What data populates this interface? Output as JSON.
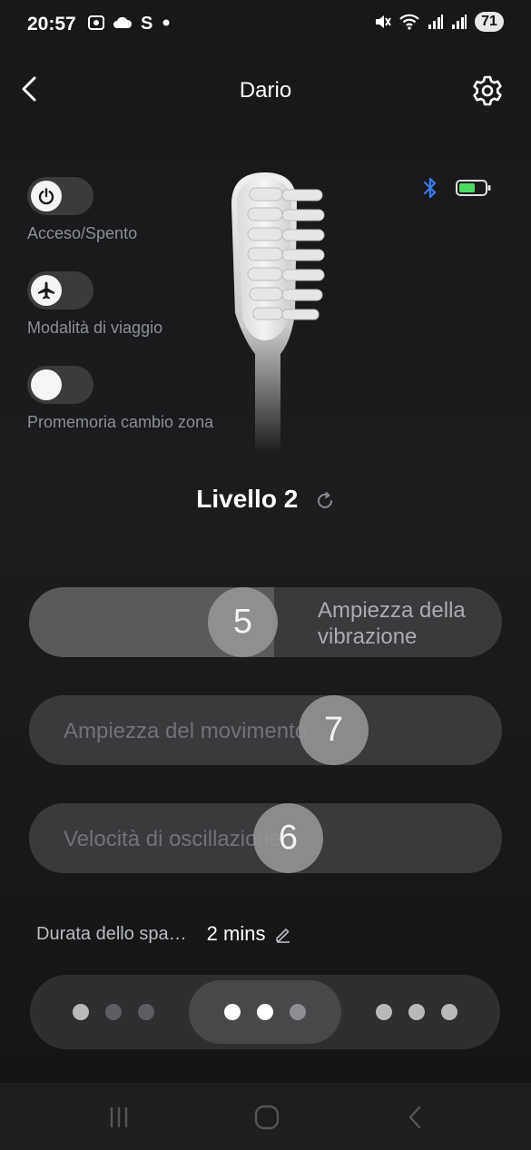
{
  "status_bar": {
    "time": "20:57",
    "battery_percent": "71",
    "icons": [
      "screenshot-icon",
      "cloud-icon",
      "s-app-icon",
      "notification-dot-icon",
      "mute-icon",
      "wifi-icon",
      "signal-icon",
      "signal-icon-2"
    ]
  },
  "header": {
    "title": "Dario",
    "back_icon": "chevron-left-icon",
    "settings_icon": "gear-icon"
  },
  "toggles": [
    {
      "label": "Acceso/Spento",
      "icon": "power-icon",
      "on": false
    },
    {
      "label": "Modalità di viaggio",
      "icon": "airplane-icon",
      "on": false
    },
    {
      "label": "Promemoria cambio zona",
      "icon": "",
      "on": false
    }
  ],
  "device": {
    "bluetooth_icon": "bluetooth-icon",
    "battery_icon": "battery-icon",
    "battery_color": "#4cd964"
  },
  "level": {
    "label": "Livello 2",
    "refresh_icon": "refresh-icon"
  },
  "sliders": [
    {
      "label_line1": "Ampiezza della",
      "label_line2": "vibrazione",
      "value": "5"
    },
    {
      "label": "Ampiezza del movimento",
      "value": "7"
    },
    {
      "label": "Velocità di oscillazione",
      "value": "6"
    }
  ],
  "duration": {
    "label": "Durata dello spa…",
    "value": "2 mins",
    "edit_icon": "pencil-icon"
  },
  "modes": {
    "selected_index": 1,
    "segments": [
      {
        "dots": [
          true,
          false,
          false
        ]
      },
      {
        "dots": [
          true,
          true,
          false
        ]
      },
      {
        "dots": [
          true,
          true,
          true
        ]
      }
    ]
  },
  "colors": {
    "accent_bluetooth": "#3d7cf5",
    "battery_green": "#4cd964"
  }
}
